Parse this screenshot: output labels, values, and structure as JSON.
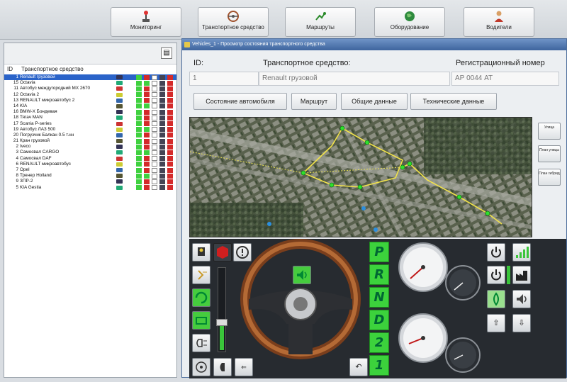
{
  "toolbar": {
    "buttons": [
      {
        "label": "Мониторинг",
        "icon": "joystick-icon"
      },
      {
        "label": "Транспортное средство",
        "icon": "steering-wheel-icon"
      },
      {
        "label": "Маршруты",
        "icon": "route-icon"
      },
      {
        "label": "Оборудование",
        "icon": "globe-icon"
      },
      {
        "label": "Водители",
        "icon": "driver-icon"
      }
    ]
  },
  "vehicle_list": {
    "columns": {
      "id": "ID",
      "name": "Транспортное средство"
    },
    "rows": [
      {
        "id": "1",
        "name": "Renault грузовой",
        "selected": true
      },
      {
        "id": "15",
        "name": "Octavia"
      },
      {
        "id": "11",
        "name": "Автобус междугородний МХ 2670"
      },
      {
        "id": "12",
        "name": "Octavia 2"
      },
      {
        "id": "13",
        "name": "RENAULT микроавтобус 2"
      },
      {
        "id": "14",
        "name": "KIA"
      },
      {
        "id": "16",
        "name": "BMW-X Бондевая"
      },
      {
        "id": "18",
        "name": "Тягач MAN"
      },
      {
        "id": "17",
        "name": "Scania Р-series"
      },
      {
        "id": "19",
        "name": "Автобус ЛАЗ 500"
      },
      {
        "id": "20",
        "name": "Погрузчик Балкан 0.5 т.нн"
      },
      {
        "id": "21",
        "name": "Кран грузовой"
      },
      {
        "id": "2",
        "name": "Iveco"
      },
      {
        "id": "3",
        "name": "Самосвал CARGO"
      },
      {
        "id": "4",
        "name": "Самосвал DAF"
      },
      {
        "id": "6",
        "name": "RENAULT микроавтобус"
      },
      {
        "id": "7",
        "name": "Opel"
      },
      {
        "id": "8",
        "name": "Тренер Holland"
      },
      {
        "id": "9",
        "name": "ЗПР-2"
      },
      {
        "id": "5",
        "name": "KIA Gestia"
      }
    ],
    "colors": {
      "green": "#3fd13f",
      "red": "#d42a2a",
      "selection": "#2a63c9"
    }
  },
  "window": {
    "title": "Vehicles_1 - Просмотр состояния транспортного средства",
    "fields": {
      "id_label": "ID:",
      "id_value": "1",
      "vehicle_label": "Транспортное средство:",
      "vehicle_value": "Renault грузовой",
      "reg_label": "Регистрационный номер",
      "reg_value": "АР 0044 АТ"
    },
    "tabs": [
      "Состояние автомобиля",
      "Маршрут",
      "Общие данные",
      "Технические данные"
    ],
    "map_side_buttons": [
      "Улица",
      "План улицы",
      "План гибрид"
    ],
    "gears": [
      "P",
      "R",
      "N",
      "D",
      "2",
      "1"
    ],
    "accent": "#3cd23c"
  }
}
